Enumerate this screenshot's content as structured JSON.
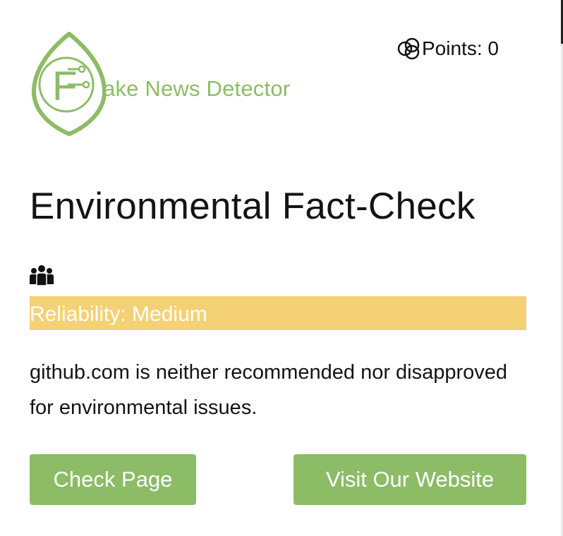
{
  "header": {
    "logo_letter": "F",
    "app_title": "ake News Detector",
    "points_label": "Points: 0",
    "points_icon": "rings-icon"
  },
  "main": {
    "title": "Environmental Fact-Check",
    "audience_icon": "people-group-icon",
    "reliability_label": "Reliability: Medium",
    "description": "github.com is neither recommended nor disapproved for environmental issues."
  },
  "actions": {
    "check_page": "Check Page",
    "visit_website": "Visit Our Website"
  },
  "colors": {
    "brand_green": "#8cbc66",
    "reliability_medium": "#f5d176",
    "text": "#141414"
  }
}
